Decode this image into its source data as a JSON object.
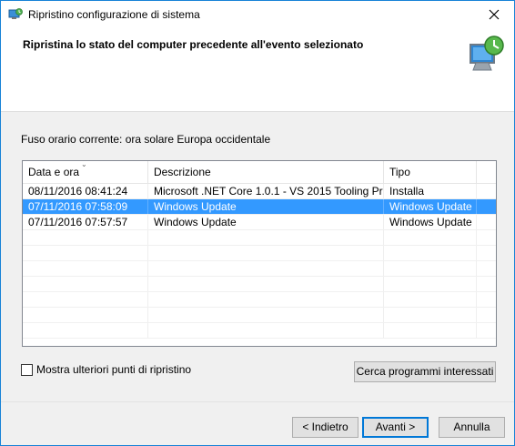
{
  "window": {
    "title": "Ripristino configurazione di sistema"
  },
  "header": {
    "title": "Ripristina lo stato del computer precedente all'evento selezionato"
  },
  "timezone_label": "Fuso orario corrente: ora solare Europa occidentale",
  "table": {
    "columns": [
      "Data e ora",
      "Descrizione",
      "Tipo"
    ],
    "rows": [
      {
        "date": "08/11/2016 08:41:24",
        "description": "Microsoft .NET Core 1.0.1 - VS 2015 Tooling Pre...",
        "type": "Installa",
        "selected": false
      },
      {
        "date": "07/11/2016 07:58:09",
        "description": "Windows Update",
        "type": "Windows Update",
        "selected": true
      },
      {
        "date": "07/11/2016 07:57:57",
        "description": "Windows Update",
        "type": "Windows Update",
        "selected": false
      }
    ]
  },
  "checkbox": {
    "label": "Mostra ulteriori punti di ripristino",
    "checked": false
  },
  "buttons": {
    "affected": "Cerca programmi interessati",
    "back": "< Indietro",
    "next": "Avanti >",
    "cancel": "Annulla"
  },
  "colors": {
    "selection": "#3399ff",
    "accent": "#0078d7"
  }
}
